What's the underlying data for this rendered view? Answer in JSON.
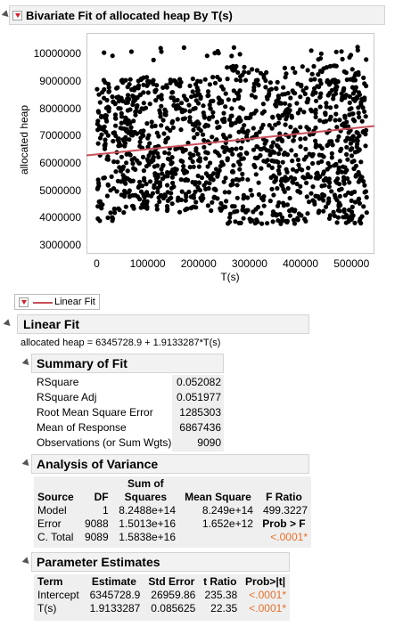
{
  "report": {
    "title": "Bivariate Fit of allocated heap By T(s)"
  },
  "plot": {
    "xlabel": "T(s)",
    "ylabel": "allocated heap",
    "x_ticks": [
      "0",
      "100000",
      "200000",
      "300000",
      "400000",
      "500000"
    ],
    "y_ticks": [
      "3000000",
      "4000000",
      "5000000",
      "6000000",
      "7000000",
      "8000000",
      "9000000",
      "10000000"
    ],
    "fit_line_color": "#c8505a",
    "point_color": "#000000"
  },
  "chart_data": {
    "type": "scatter",
    "title": "Bivariate Fit of allocated heap By T(s)",
    "xlabel": "T(s)",
    "ylabel": "allocated heap",
    "xlim": [
      -20000,
      545000
    ],
    "ylim": [
      2700000,
      10800000
    ],
    "fit_line": {
      "intercept": 6345728.9,
      "slope": 1.9133287
    },
    "point_count": 9090
  },
  "legend": {
    "label": "Linear Fit"
  },
  "linear_fit": {
    "title": "Linear Fit",
    "equation": "allocated heap = 6345728.9 + 1.9133287*T(s)"
  },
  "summary": {
    "title": "Summary of Fit",
    "rows": [
      {
        "label": "RSquare",
        "value": "0.052082"
      },
      {
        "label": "RSquare Adj",
        "value": "0.051977"
      },
      {
        "label": "Root Mean Square Error",
        "value": "1285303"
      },
      {
        "label": "Mean of Response",
        "value": "6867436"
      },
      {
        "label": "Observations (or Sum Wgts)",
        "value": "9090"
      }
    ]
  },
  "anova": {
    "title": "Analysis of Variance",
    "header_top": [
      "",
      "",
      "Sum of",
      "",
      ""
    ],
    "header": [
      "Source",
      "DF",
      "Squares",
      "Mean Square",
      "F Ratio"
    ],
    "rows": [
      [
        "Model",
        "1",
        "8.2488e+14",
        "8.249e+14",
        "499.3227"
      ],
      [
        "Error",
        "9088",
        "1.5013e+16",
        "1.652e+12",
        "Prob > F"
      ],
      [
        "C. Total",
        "9089",
        "1.5838e+16",
        "",
        "<.0001*"
      ]
    ]
  },
  "params": {
    "title": "Parameter Estimates",
    "header": [
      "Term",
      "Estimate",
      "Std Error",
      "t Ratio",
      "Prob>|t|"
    ],
    "rows": [
      [
        "Intercept",
        "6345728.9",
        "26959.86",
        "235.38",
        "<.0001*"
      ],
      [
        "T(s)",
        "1.9133287",
        "0.085625",
        "22.35",
        "<.0001*"
      ]
    ]
  },
  "colors": {
    "significant": "#e8702a",
    "header_bg": "#f2f2f2",
    "table_bg": "#efefef"
  }
}
